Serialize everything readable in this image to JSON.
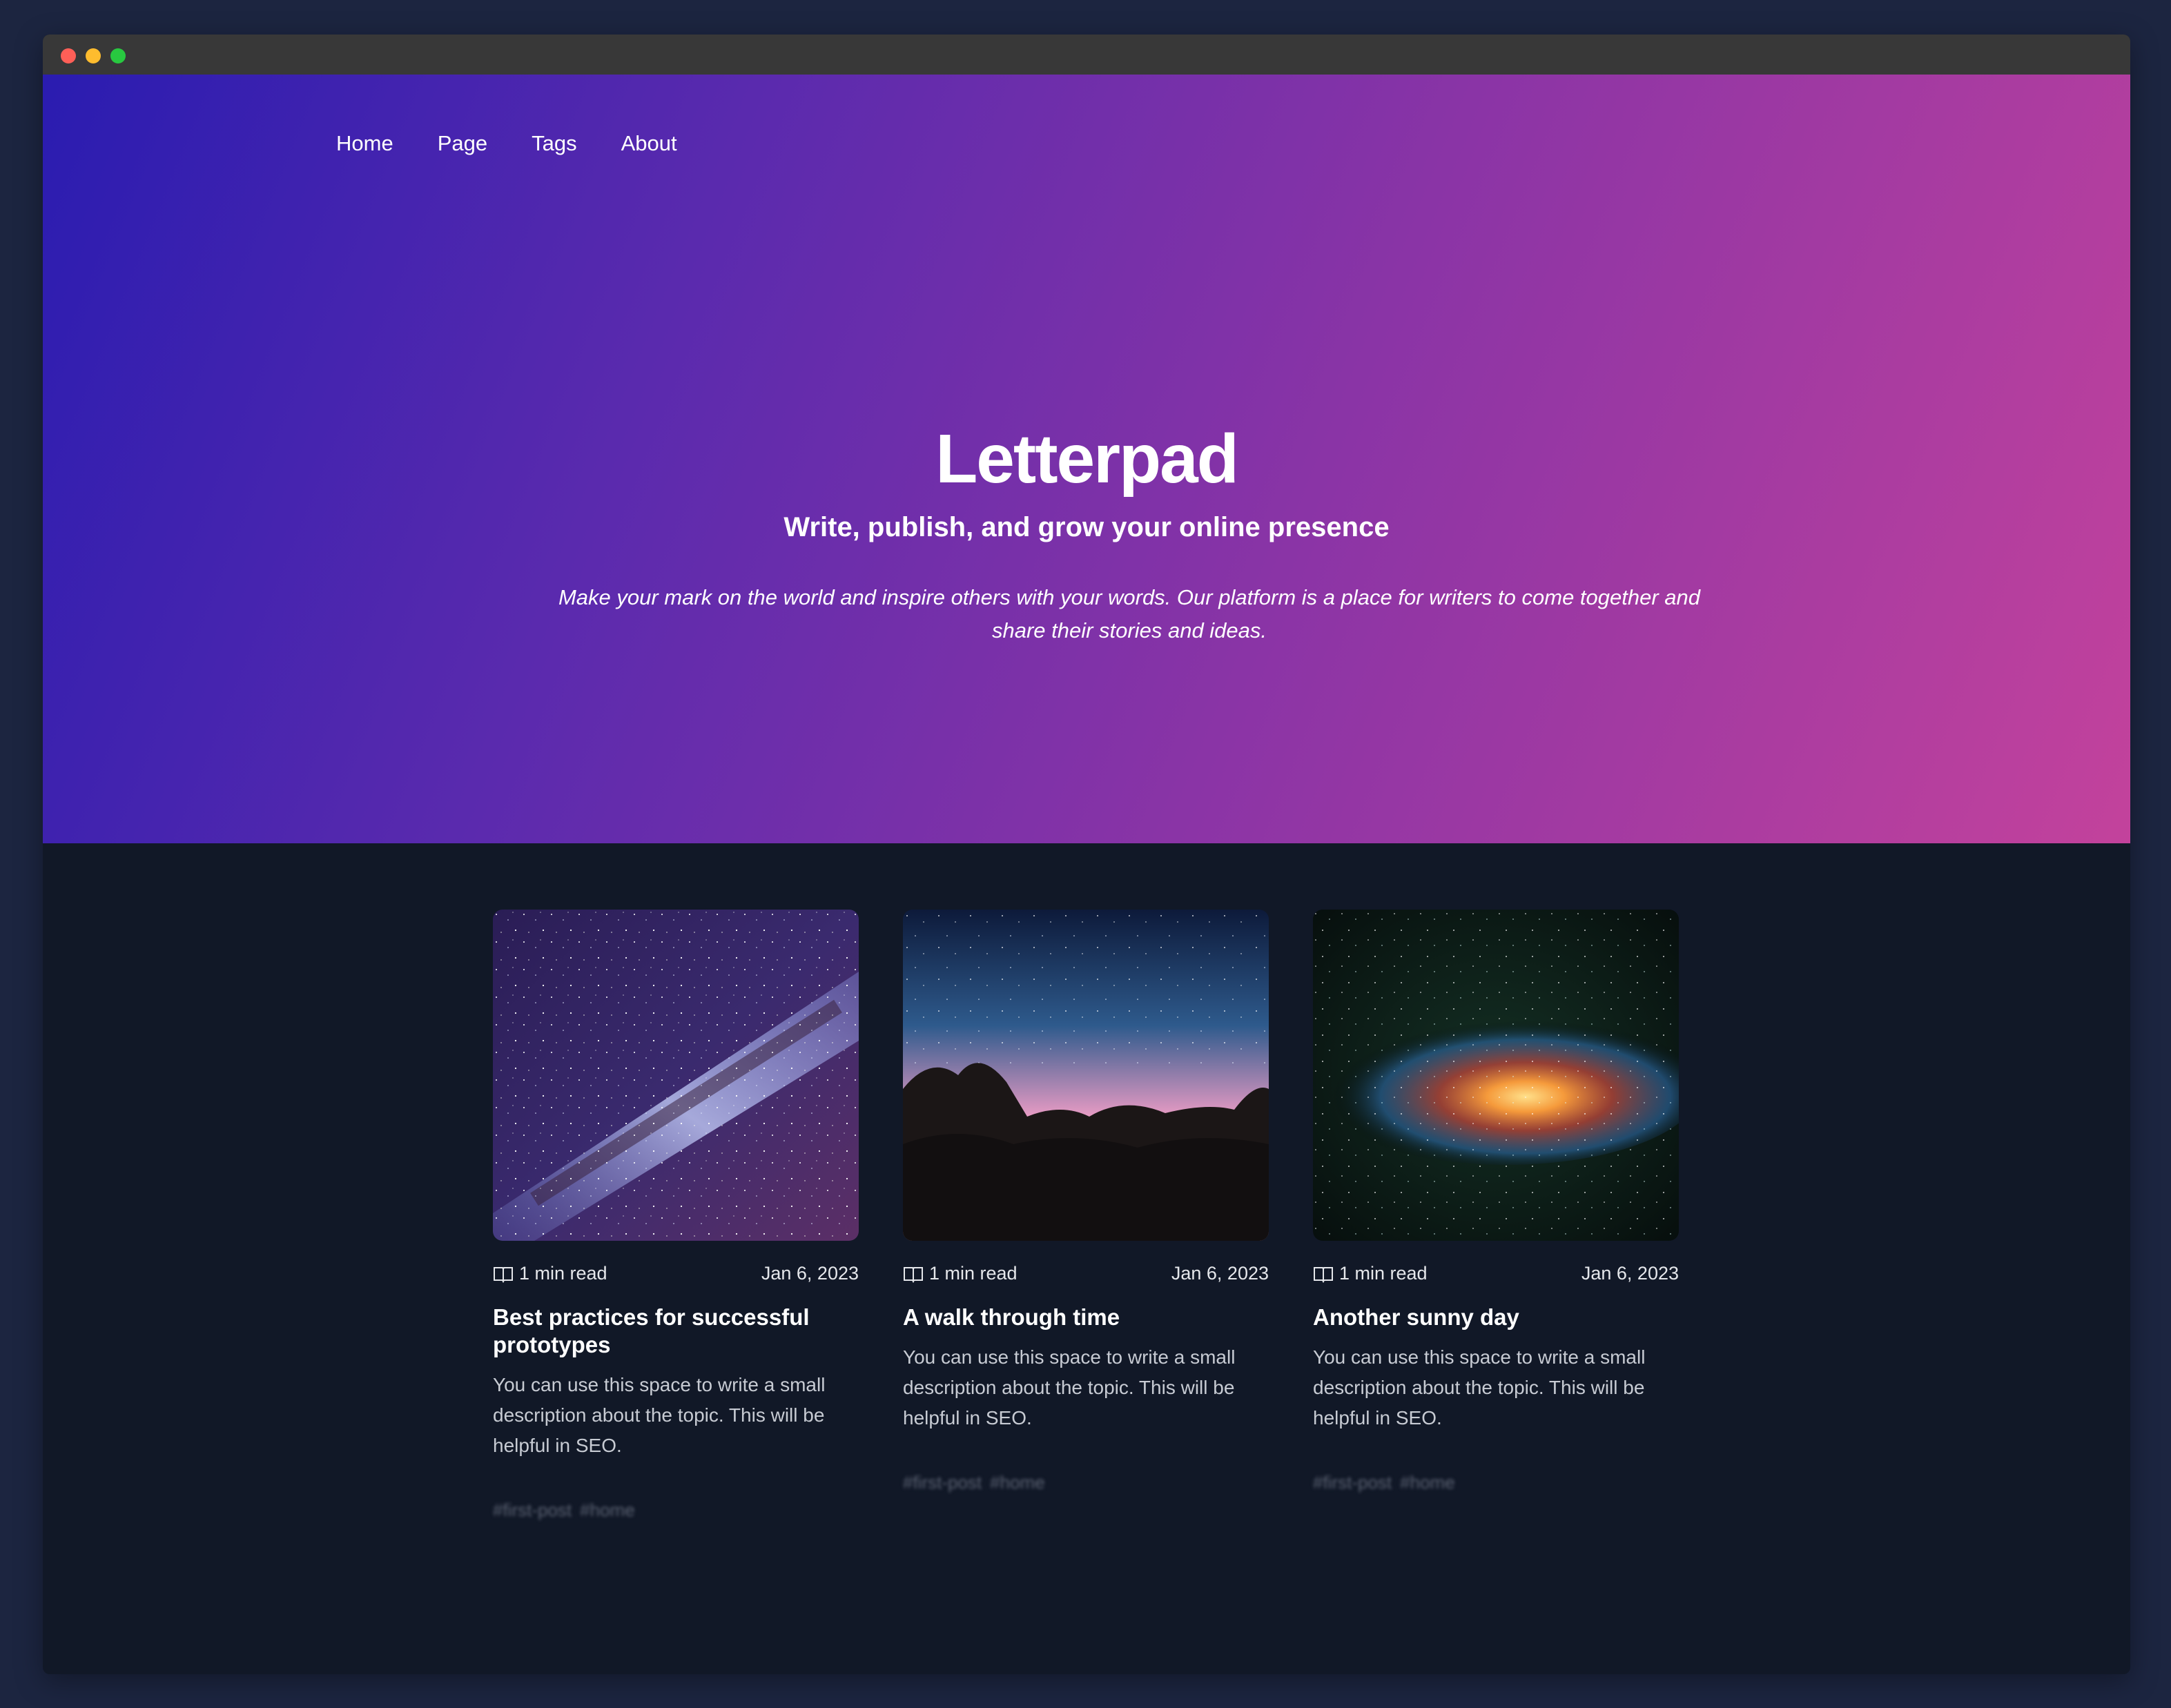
{
  "nav": {
    "items": [
      {
        "label": "Home"
      },
      {
        "label": "Page"
      },
      {
        "label": "Tags"
      },
      {
        "label": "About"
      }
    ]
  },
  "hero": {
    "title": "Letterpad",
    "subtitle": "Write, publish, and grow your online presence",
    "description": "Make your mark on the world and inspire others with your words. Our platform is a place for writers to come together and share their stories and ideas."
  },
  "posts": [
    {
      "image": "milky-way-image",
      "read_time": "1 min read",
      "date": "Jan 6, 2023",
      "title": "Best practices for successful prototypes",
      "description": "You can use this space to write a small description about the topic. This will be helpful in SEO.",
      "tags": [
        "#first-post",
        "#home"
      ]
    },
    {
      "image": "rocky-sunset-night-image",
      "read_time": "1 min read",
      "date": "Jan 6, 2023",
      "title": "A walk through time",
      "description": "You can use this space to write a small description about the topic. This will be helpful in SEO.",
      "tags": [
        "#first-post",
        "#home"
      ]
    },
    {
      "image": "galaxy-core-image",
      "read_time": "1 min read",
      "date": "Jan 6, 2023",
      "title": "Another sunny day",
      "description": "You can use this space to write a small description about the topic. This will be helpful in SEO.",
      "tags": [
        "#first-post",
        "#home"
      ]
    }
  ],
  "colors": {
    "page_bg": "#1c2540",
    "content_bg": "#111827",
    "gradient_start": "#2a1cb0",
    "gradient_end": "#c3429c"
  }
}
